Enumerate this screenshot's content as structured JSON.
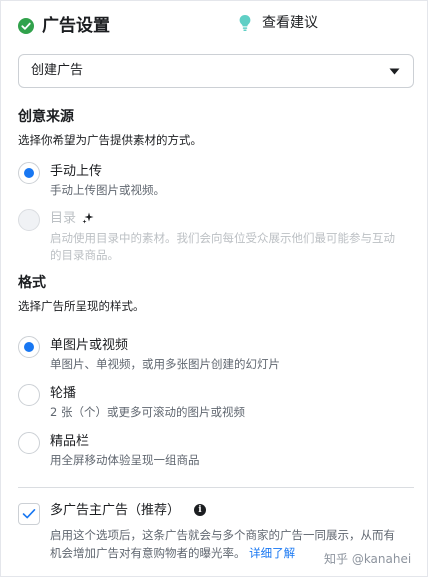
{
  "header": {
    "title": "广告设置",
    "tip_label": "查看建议"
  },
  "ad_select": {
    "value": "创建广告"
  },
  "creative_source": {
    "title": "创意来源",
    "subtitle": "选择你希望为广告提供素材的方式。",
    "options": [
      {
        "label": "手动上传",
        "description": "手动上传图片或视频。",
        "selected": true,
        "disabled": false
      },
      {
        "label": "目录",
        "description_line1": "启动使用目录中的素材。我们会向每位受众展示他们最可能参与互动",
        "description_line2": "的目录商品。",
        "selected": false,
        "disabled": true
      }
    ]
  },
  "format": {
    "title": "格式",
    "subtitle": "选择广告所呈现的样式。",
    "options": [
      {
        "label": "单图片或视频",
        "description": "单图片、单视频，或用多张图片创建的幻灯片",
        "selected": true
      },
      {
        "label": "轮播",
        "description": "2 张（个）或更多可滚动的图片或视频",
        "selected": false
      },
      {
        "label": "精品栏",
        "description": "用全屏移动体验呈现一组商品",
        "selected": false
      }
    ]
  },
  "multi_advertiser": {
    "label": "多广告主广告（推荐）",
    "checked": true,
    "info_glyph": "i",
    "description_line1": "启用这个选项后，这条广告就会与多个商家的广告一同展示，从而有",
    "description_line2": "机会增加广告对有意购物者的曝光率。",
    "learn_more": "详细了解"
  },
  "watermark": "知乎 @kanahei",
  "colors": {
    "accent": "#1877f2",
    "success": "#31a24c",
    "tip": "#5fcfc5"
  }
}
